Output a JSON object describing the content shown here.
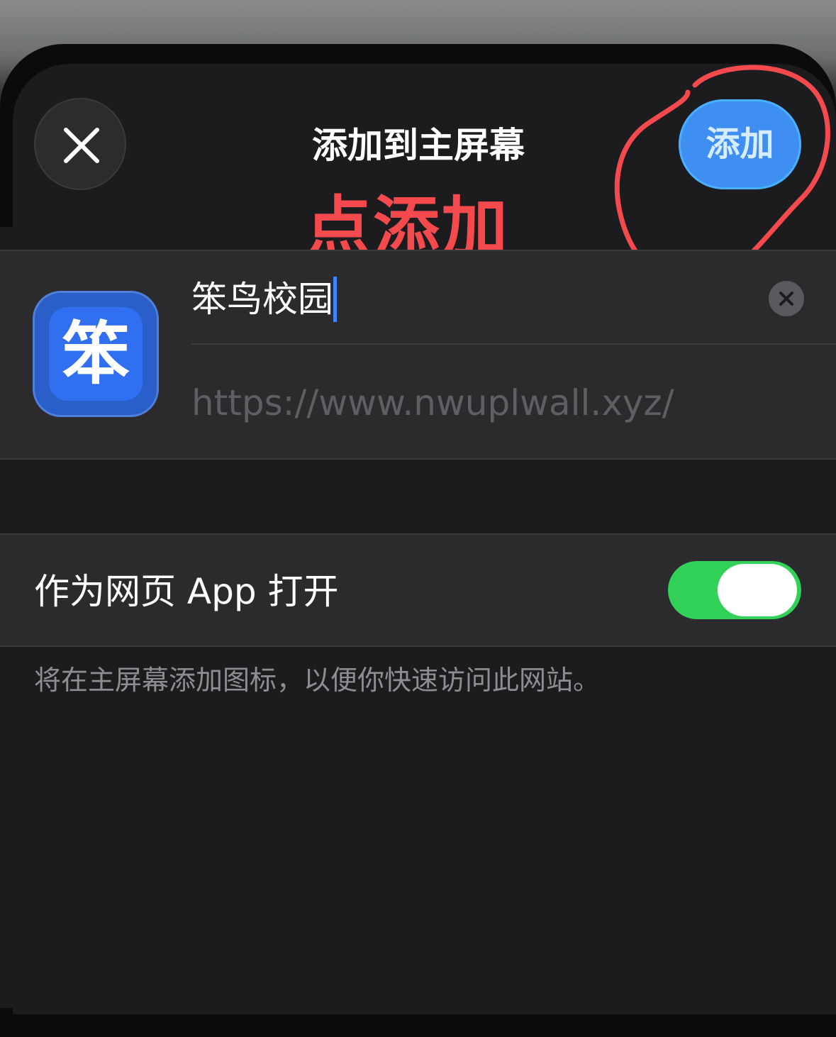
{
  "header": {
    "close_icon": "close-icon",
    "title": "添加到主屏幕",
    "add_label": "添加"
  },
  "annotation": {
    "text": "点添加",
    "color": "#f44a4e"
  },
  "bookmark": {
    "icon_glyph": "笨",
    "name_value": "笨鸟校园",
    "url_value": "https://www.nwuplwall.xyz/",
    "clear_icon": "clear-icon"
  },
  "settings": {
    "open_as_web_app_label": "作为网页 App 打开",
    "open_as_web_app_enabled": true,
    "toggle_color": "#32d158"
  },
  "footer": {
    "note": "将在主屏幕添加图标，以便你快速访问此网站。"
  },
  "colors": {
    "accent_blue": "#3f8ef2",
    "background": "#1c1c1e"
  }
}
